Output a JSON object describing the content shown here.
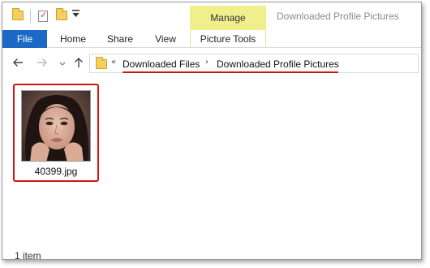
{
  "window": {
    "title": "Downloaded Profile Pictures",
    "contextual_tab": "Manage"
  },
  "quick_access": {
    "icons": [
      "folder-icon",
      "properties-icon",
      "new-folder-icon",
      "customize-dropdown-icon"
    ]
  },
  "ribbon": {
    "tabs": [
      {
        "label": "File",
        "active": true
      },
      {
        "label": "Home"
      },
      {
        "label": "Share"
      },
      {
        "label": "View"
      },
      {
        "label": "Picture Tools"
      }
    ],
    "accent_color": "#1c69c5",
    "contextual_color": "#f1ef8c"
  },
  "navigation": {
    "back_icon": "arrow-left-icon",
    "forward_icon": "arrow-right-icon",
    "recent_icon": "chevron-down-icon",
    "up_icon": "arrow-up-icon"
  },
  "address_bar": {
    "overflow_glyph": "«",
    "separator_glyph": "›",
    "breadcrumbs": [
      "Downloaded Files",
      "Downloaded Profile Pictures"
    ],
    "highlight_color": "#d01313"
  },
  "files": [
    {
      "name": "40399.jpg",
      "selected_outline_color": "#d01313"
    }
  ],
  "status": {
    "item_count": "1 item"
  }
}
